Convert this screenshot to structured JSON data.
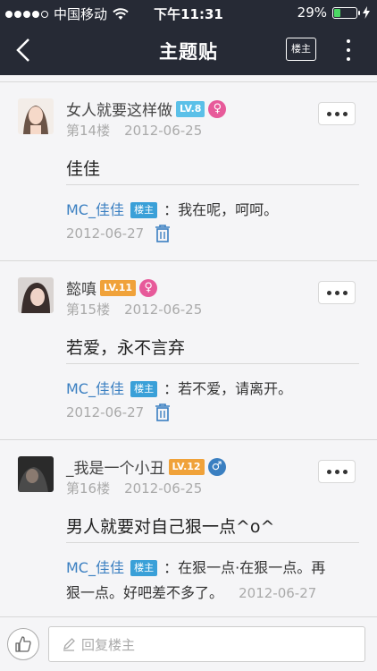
{
  "status_bar": {
    "carrier": "中国移动",
    "time": "下午11:31",
    "battery_percent": "29%",
    "battery_level": 0.29
  },
  "nav": {
    "title": "主题贴",
    "owner_button": "楼主"
  },
  "posts": [
    {
      "username": "女人就要这样做",
      "level": "LV.8",
      "level_color": "#5bc0e8",
      "gender": "♀",
      "gender_color": "#e75a9a",
      "floor": "第14楼",
      "date": "2012-06-25",
      "content": "佳佳",
      "reply": {
        "name": "MC_佳佳",
        "tag": "楼主",
        "text": "：我在呢，呵呵。",
        "date": "2012-06-27"
      }
    },
    {
      "username": "懿嗔",
      "level": "LV.11",
      "level_color": "#f0a23a",
      "gender": "♀",
      "gender_color": "#e75a9a",
      "floor": "第15楼",
      "date": "2012-06-25",
      "content": "若爱，永不言弃",
      "reply": {
        "name": "MC_佳佳",
        "tag": "楼主",
        "text": "：若不爱，请离开。",
        "date": "2012-06-27"
      }
    },
    {
      "username": "_我是一个小丑",
      "level": "LV.12",
      "level_color": "#f0a23a",
      "gender": "♂",
      "gender_color": "#3a7fc1",
      "floor": "第16楼",
      "date": "2012-06-25",
      "content": "男人就要对自己狠一点^o^",
      "reply": {
        "name": "MC_佳佳",
        "tag": "楼主",
        "text": "：在狠一点·在狠一点。再",
        "text_line2": "狠一点。好吧差不多了。",
        "date": "2012-06-27"
      }
    }
  ],
  "bottom": {
    "reply_placeholder": "回复楼主"
  },
  "icons": {
    "back": "chevron-left-icon",
    "more": "vertical-dots-icon",
    "trash": "trash-icon",
    "like": "thumbs-up-icon",
    "pencil": "pencil-icon"
  }
}
